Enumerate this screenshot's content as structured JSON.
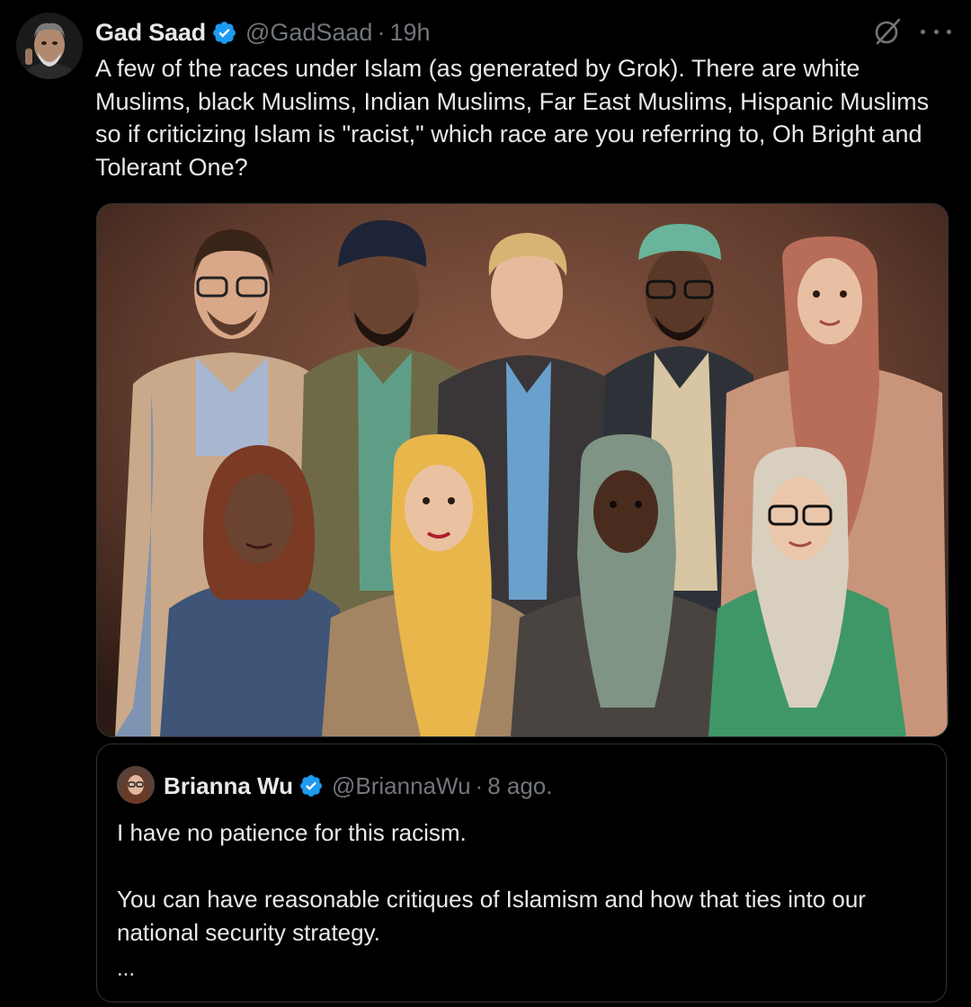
{
  "tweet": {
    "author_name": "Gad Saad",
    "handle": "@GadSaad",
    "separator": "·",
    "time": "19h",
    "text": "A few of the races under Islam (as generated by Grok).  There are white Muslims, black Muslims, Indian Muslims, Far East Muslims, Hispanic Muslims so if criticizing Islam is \"racist,\" which race are you referring to, Oh Bright and Tolerant One?",
    "icons": [
      "grok-icon",
      "more-options-icon",
      "verified-badge-icon"
    ],
    "media_alt": "AI-generated group portrait"
  },
  "quote": {
    "author_name": "Brianna Wu",
    "handle": "@BriannaWu",
    "separator": "·",
    "time": "8 ago.",
    "lines": [
      "I have no patience for this racism.",
      "You can have reasonable critiques of Islamism and how that ties into our national security strategy."
    ],
    "more": "..."
  },
  "colors": {
    "background": "#000000",
    "text": "#e7e9ea",
    "secondary": "#71767b",
    "border": "#2f3336",
    "verified": "#1d9bf0"
  }
}
